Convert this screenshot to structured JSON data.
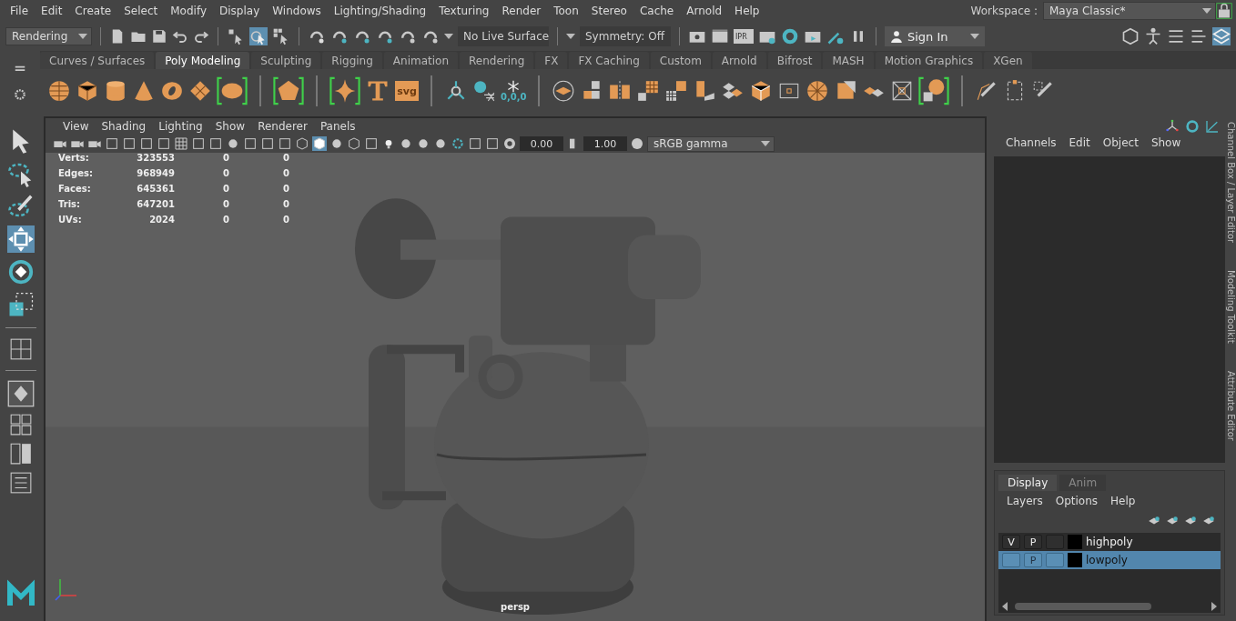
{
  "menu_bar": [
    "File",
    "Edit",
    "Create",
    "Select",
    "Modify",
    "Display",
    "Windows",
    "Lighting/Shading",
    "Texturing",
    "Render",
    "Toon",
    "Stereo",
    "Cache",
    "Arnold",
    "Help"
  ],
  "workspace": {
    "label": "Workspace :",
    "value": "Maya Classic*"
  },
  "status_line": {
    "menu_set": "Rendering",
    "select_modes": [
      {
        "selected": false
      },
      {
        "selected": true
      },
      {
        "selected": false
      }
    ],
    "live_surface": "No Live Surface",
    "symmetry": "Symmetry: Off",
    "ipr_label": "IPR",
    "sign_in": "Sign In"
  },
  "shelf": {
    "tabs": [
      {
        "label": "Curves / Surfaces",
        "selected": false
      },
      {
        "label": "Poly Modeling",
        "selected": true
      },
      {
        "label": "Sculpting",
        "selected": false
      },
      {
        "label": "Rigging",
        "selected": false
      },
      {
        "label": "Animation",
        "selected": false
      },
      {
        "label": "Rendering",
        "selected": false
      },
      {
        "label": "FX",
        "selected": false
      },
      {
        "label": "FX Caching",
        "selected": false
      },
      {
        "label": "Custom",
        "selected": false
      },
      {
        "label": "Arnold",
        "selected": false
      },
      {
        "label": "Bifrost",
        "selected": false
      },
      {
        "label": "MASH",
        "selected": false
      },
      {
        "label": "Motion Graphics",
        "selected": false
      },
      {
        "label": "XGen",
        "selected": false
      }
    ],
    "svg_label": "svg",
    "snap_label": "0,0,0"
  },
  "toolbox": {
    "tools": [
      {
        "selected": false
      },
      {
        "selected": false
      },
      {
        "selected": false
      },
      {
        "selected": true
      },
      {
        "selected": false
      },
      {
        "selected": false
      }
    ]
  },
  "viewport": {
    "menu": [
      "View",
      "Shading",
      "Lighting",
      "Show",
      "Renderer",
      "Panels"
    ],
    "exposure": "0.00",
    "gamma": "1.00",
    "color_space": "sRGB gamma",
    "hud": [
      {
        "label": "Verts:",
        "values": [
          "323553",
          "0",
          "0"
        ]
      },
      {
        "label": "Edges:",
        "values": [
          "968949",
          "0",
          "0"
        ]
      },
      {
        "label": "Faces:",
        "values": [
          "645361",
          "0",
          "0"
        ]
      },
      {
        "label": "Tris:",
        "values": [
          "647201",
          "0",
          "0"
        ]
      },
      {
        "label": "UVs:",
        "values": [
          "2024",
          "0",
          "0"
        ]
      }
    ],
    "camera": "persp"
  },
  "channel_box": {
    "menu": [
      "Channels",
      "Edit",
      "Object",
      "Show"
    ]
  },
  "layer_editor": {
    "tabs": [
      {
        "label": "Display",
        "selected": true
      },
      {
        "label": "Anim",
        "selected": false
      }
    ],
    "menu": [
      "Layers",
      "Options",
      "Help"
    ],
    "layers": [
      {
        "visibility_label": "V",
        "playback_label": "P",
        "name": "highpoly",
        "selected": false
      },
      {
        "playback_label": "P",
        "name": "lowpoly",
        "selected": true
      }
    ]
  },
  "side_tabs": [
    "Channel Box / Layer Editor",
    "Modeling Toolkit",
    "Attribute Editor"
  ]
}
